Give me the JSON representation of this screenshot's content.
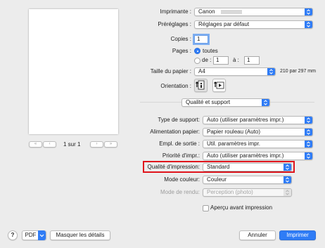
{
  "preview": {
    "page_indicator": "1 sur 1"
  },
  "settings": {
    "printer_label": "Imprimante :",
    "printer_value": "Canon",
    "presets_label": "Préréglages :",
    "presets_value": "Réglages par défaut",
    "copies_label": "Copies :",
    "copies_value": "1",
    "pages_label": "Pages :",
    "pages_all": "toutes",
    "pages_from": "de :",
    "pages_from_value": "1",
    "pages_to": "à :",
    "pages_to_value": "1",
    "paper_size_label": "Taille du papier :",
    "paper_size_value": "A4",
    "paper_size_dims": "210 par 297 mm",
    "orientation_label": "Orientation :",
    "section_value": "Qualité et support",
    "media_type_label": "Type de support:",
    "media_type_value": "Auto (utiliser paramètres impr.)",
    "paper_source_label": "Alimentation papier:",
    "paper_source_value": "Papier rouleau (Auto)",
    "output_slot_label": "Empl. de sortie :",
    "output_slot_value": "Util. paramètres impr.",
    "print_priority_label": "Priorité d'impr.:",
    "print_priority_value": "Auto (utiliser paramètres impr.)",
    "print_quality_label": "Qualité d'impression:",
    "print_quality_value": "Standard",
    "color_mode_label": "Mode couleur:",
    "color_mode_value": "Couleur",
    "rendering_label": "Mode de rendu:",
    "rendering_value": "Perception (photo)",
    "preview_checkbox_label": "Aperçu avant impression"
  },
  "footer": {
    "help": "?",
    "pdf": "PDF",
    "hide_details": "Masquer les détails",
    "cancel": "Annuler",
    "print": "Imprimer"
  },
  "colors": {
    "accent": "#2f7cf6",
    "highlight_border": "#e0141c"
  },
  "icons": {
    "stepper": "up-down-chevron-icon",
    "portrait": "portrait-orientation-icon",
    "landscape": "landscape-orientation-icon",
    "pdf_menu": "chevron-down-icon"
  }
}
